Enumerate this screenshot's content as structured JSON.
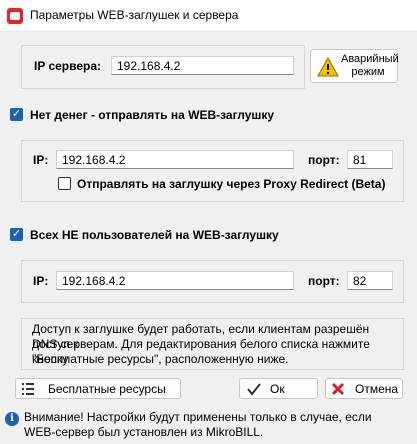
{
  "window": {
    "title": "Параметры WEB-заглушек и сервера"
  },
  "server": {
    "ip_label": "IP сервера:",
    "ip_value": "192.168.4.2",
    "emergency_button": "Аварийный режим"
  },
  "no_money": {
    "checkbox_label": "Нет денег - отправлять на WEB-заглушку",
    "checked": true,
    "ip_label": "IP:",
    "ip_value": "192.168.4.2",
    "port_label": "порт:",
    "port_value": "81",
    "proxy_checkbox_label": "Отправлять на заглушку через Proxy Redirect (Beta)",
    "proxy_checked": false
  },
  "non_users": {
    "checkbox_label": "Всех НЕ пользователей на WEB-заглушку",
    "checked": true,
    "ip_label": "IP:",
    "ip_value": "192.168.4.2",
    "port_label": "порт:",
    "port_value": "82"
  },
  "info": {
    "line1": "Доступ к заглушке будет работать, если клиентам разрешён доступ к",
    "line2": "DNS серверам. Для редактирования белого списка нажмите кнопку",
    "line3": "\"Бесплатные ресурсы\", расположенную ниже."
  },
  "buttons": {
    "free_resources": "Бесплатные ресурсы",
    "ok": "Ок",
    "cancel": "Отмена"
  },
  "footer": {
    "line1": "Внимание! Настройки будут применены только в случае, если",
    "line2": "WEB-сервер был установлен из MikroBILL."
  },
  "colors": {
    "accent": "#1f5fb0",
    "cancel_red": "#d0202a",
    "ok_green": "#2d8a3a"
  }
}
